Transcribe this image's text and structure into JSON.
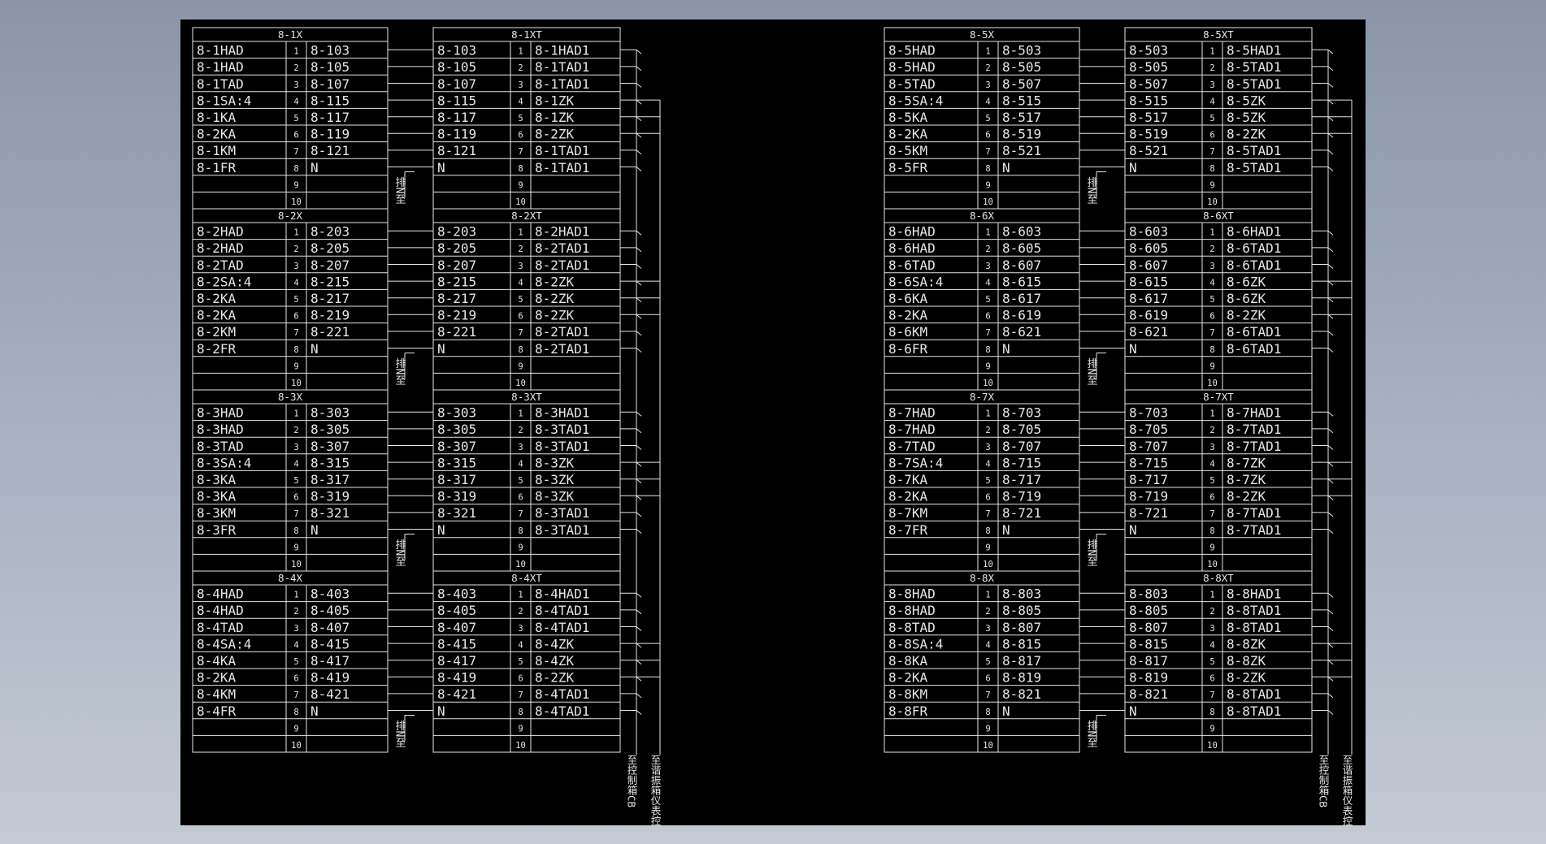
{
  "colors": {
    "paper": "#000000",
    "ink": "#e6e6e6",
    "background_top": "#8a96a8",
    "background_bottom": "#c4cad4"
  },
  "vertical_note": "排N至",
  "bottom_labels": {
    "control": "至控制箱CB",
    "meter": "至谐振箱仪表控制箱"
  },
  "sections": [
    {
      "x_title": "8-1X",
      "xt_title": "8-1XT",
      "x_rows": [
        [
          "8-1HAD",
          "1",
          "8-103"
        ],
        [
          "8-1HAD",
          "2",
          "8-105"
        ],
        [
          "8-1TAD",
          "3",
          "8-107"
        ],
        [
          "8-1SA:4",
          "4",
          "8-115"
        ],
        [
          "8-1KA",
          "5",
          "8-117"
        ],
        [
          "8-2KA",
          "6",
          "8-119"
        ],
        [
          "8-1KM",
          "7",
          "8-121"
        ],
        [
          "8-1FR",
          "8",
          "N"
        ],
        [
          "",
          "9",
          ""
        ],
        [
          "",
          "10",
          ""
        ]
      ],
      "xt_rows": [
        [
          "8-103",
          "1",
          "8-1HAD1"
        ],
        [
          "8-105",
          "2",
          "8-1TAD1"
        ],
        [
          "8-107",
          "3",
          "8-1TAD1"
        ],
        [
          "8-115",
          "4",
          "8-1ZK"
        ],
        [
          "8-117",
          "5",
          "8-1ZK"
        ],
        [
          "8-119",
          "6",
          "8-2ZK"
        ],
        [
          "8-121",
          "7",
          "8-1TAD1"
        ],
        [
          "N",
          "8",
          "8-1TAD1"
        ],
        [
          "",
          "9",
          ""
        ],
        [
          "",
          "10",
          ""
        ]
      ]
    },
    {
      "x_title": "8-2X",
      "xt_title": "8-2XT",
      "x_rows": [
        [
          "8-2HAD",
          "1",
          "8-203"
        ],
        [
          "8-2HAD",
          "2",
          "8-205"
        ],
        [
          "8-2TAD",
          "3",
          "8-207"
        ],
        [
          "8-2SA:4",
          "4",
          "8-215"
        ],
        [
          "8-2KA",
          "5",
          "8-217"
        ],
        [
          "8-2KA",
          "6",
          "8-219"
        ],
        [
          "8-2KM",
          "7",
          "8-221"
        ],
        [
          "8-2FR",
          "8",
          "N"
        ],
        [
          "",
          "9",
          ""
        ],
        [
          "",
          "10",
          ""
        ]
      ],
      "xt_rows": [
        [
          "8-203",
          "1",
          "8-2HAD1"
        ],
        [
          "8-205",
          "2",
          "8-2TAD1"
        ],
        [
          "8-207",
          "3",
          "8-2TAD1"
        ],
        [
          "8-215",
          "4",
          "8-2ZK"
        ],
        [
          "8-217",
          "5",
          "8-2ZK"
        ],
        [
          "8-219",
          "6",
          "8-2ZK"
        ],
        [
          "8-221",
          "7",
          "8-2TAD1"
        ],
        [
          "N",
          "8",
          "8-2TAD1"
        ],
        [
          "",
          "9",
          ""
        ],
        [
          "",
          "10",
          ""
        ]
      ]
    },
    {
      "x_title": "8-3X",
      "xt_title": "8-3XT",
      "x_rows": [
        [
          "8-3HAD",
          "1",
          "8-303"
        ],
        [
          "8-3HAD",
          "2",
          "8-305"
        ],
        [
          "8-3TAD",
          "3",
          "8-307"
        ],
        [
          "8-3SA:4",
          "4",
          "8-315"
        ],
        [
          "8-3KA",
          "5",
          "8-317"
        ],
        [
          "8-3KA",
          "6",
          "8-319"
        ],
        [
          "8-3KM",
          "7",
          "8-321"
        ],
        [
          "8-3FR",
          "8",
          "N"
        ],
        [
          "",
          "9",
          ""
        ],
        [
          "",
          "10",
          ""
        ]
      ],
      "xt_rows": [
        [
          "8-303",
          "1",
          "8-3HAD1"
        ],
        [
          "8-305",
          "2",
          "8-3TAD1"
        ],
        [
          "8-307",
          "3",
          "8-3TAD1"
        ],
        [
          "8-315",
          "4",
          "8-3ZK"
        ],
        [
          "8-317",
          "5",
          "8-3ZK"
        ],
        [
          "8-319",
          "6",
          "8-3ZK"
        ],
        [
          "8-321",
          "7",
          "8-3TAD1"
        ],
        [
          "N",
          "8",
          "8-3TAD1"
        ],
        [
          "",
          "9",
          ""
        ],
        [
          "",
          "10",
          ""
        ]
      ]
    },
    {
      "x_title": "8-4X",
      "xt_title": "8-4XT",
      "x_rows": [
        [
          "8-4HAD",
          "1",
          "8-403"
        ],
        [
          "8-4HAD",
          "2",
          "8-405"
        ],
        [
          "8-4TAD",
          "3",
          "8-407"
        ],
        [
          "8-4SA:4",
          "4",
          "8-415"
        ],
        [
          "8-4KA",
          "5",
          "8-417"
        ],
        [
          "8-2KA",
          "6",
          "8-419"
        ],
        [
          "8-4KM",
          "7",
          "8-421"
        ],
        [
          "8-4FR",
          "8",
          "N"
        ],
        [
          "",
          "9",
          ""
        ],
        [
          "",
          "10",
          ""
        ]
      ],
      "xt_rows": [
        [
          "8-403",
          "1",
          "8-4HAD1"
        ],
        [
          "8-405",
          "2",
          "8-4TAD1"
        ],
        [
          "8-407",
          "3",
          "8-4TAD1"
        ],
        [
          "8-415",
          "4",
          "8-4ZK"
        ],
        [
          "8-417",
          "5",
          "8-4ZK"
        ],
        [
          "8-419",
          "6",
          "8-2ZK"
        ],
        [
          "8-421",
          "7",
          "8-4TAD1"
        ],
        [
          "N",
          "8",
          "8-4TAD1"
        ],
        [
          "",
          "9",
          ""
        ],
        [
          "",
          "10",
          ""
        ]
      ]
    },
    {
      "x_title": "8-5X",
      "xt_title": "8-5XT",
      "x_rows": [
        [
          "8-5HAD",
          "1",
          "8-503"
        ],
        [
          "8-5HAD",
          "2",
          "8-505"
        ],
        [
          "8-5TAD",
          "3",
          "8-507"
        ],
        [
          "8-5SA:4",
          "4",
          "8-515"
        ],
        [
          "8-5KA",
          "5",
          "8-517"
        ],
        [
          "8-2KA",
          "6",
          "8-519"
        ],
        [
          "8-5KM",
          "7",
          "8-521"
        ],
        [
          "8-5FR",
          "8",
          "N"
        ],
        [
          "",
          "9",
          ""
        ],
        [
          "",
          "10",
          ""
        ]
      ],
      "xt_rows": [
        [
          "8-503",
          "1",
          "8-5HAD1"
        ],
        [
          "8-505",
          "2",
          "8-5TAD1"
        ],
        [
          "8-507",
          "3",
          "8-5TAD1"
        ],
        [
          "8-515",
          "4",
          "8-5ZK"
        ],
        [
          "8-517",
          "5",
          "8-5ZK"
        ],
        [
          "8-519",
          "6",
          "8-2ZK"
        ],
        [
          "8-521",
          "7",
          "8-5TAD1"
        ],
        [
          "N",
          "8",
          "8-5TAD1"
        ],
        [
          "",
          "9",
          ""
        ],
        [
          "",
          "10",
          ""
        ]
      ]
    },
    {
      "x_title": "8-6X",
      "xt_title": "8-6XT",
      "x_rows": [
        [
          "8-6HAD",
          "1",
          "8-603"
        ],
        [
          "8-6HAD",
          "2",
          "8-605"
        ],
        [
          "8-6TAD",
          "3",
          "8-607"
        ],
        [
          "8-6SA:4",
          "4",
          "8-615"
        ],
        [
          "8-6KA",
          "5",
          "8-617"
        ],
        [
          "8-2KA",
          "6",
          "8-619"
        ],
        [
          "8-6KM",
          "7",
          "8-621"
        ],
        [
          "8-6FR",
          "8",
          "N"
        ],
        [
          "",
          "9",
          ""
        ],
        [
          "",
          "10",
          ""
        ]
      ],
      "xt_rows": [
        [
          "8-603",
          "1",
          "8-6HAD1"
        ],
        [
          "8-605",
          "2",
          "8-6TAD1"
        ],
        [
          "8-607",
          "3",
          "8-6TAD1"
        ],
        [
          "8-615",
          "4",
          "8-6ZK"
        ],
        [
          "8-617",
          "5",
          "8-6ZK"
        ],
        [
          "8-619",
          "6",
          "8-2ZK"
        ],
        [
          "8-621",
          "7",
          "8-6TAD1"
        ],
        [
          "N",
          "8",
          "8-6TAD1"
        ],
        [
          "",
          "9",
          ""
        ],
        [
          "",
          "10",
          ""
        ]
      ]
    },
    {
      "x_title": "8-7X",
      "xt_title": "8-7XT",
      "x_rows": [
        [
          "8-7HAD",
          "1",
          "8-703"
        ],
        [
          "8-7HAD",
          "2",
          "8-705"
        ],
        [
          "8-7TAD",
          "3",
          "8-707"
        ],
        [
          "8-7SA:4",
          "4",
          "8-715"
        ],
        [
          "8-7KA",
          "5",
          "8-717"
        ],
        [
          "8-2KA",
          "6",
          "8-719"
        ],
        [
          "8-7KM",
          "7",
          "8-721"
        ],
        [
          "8-7FR",
          "8",
          "N"
        ],
        [
          "",
          "9",
          ""
        ],
        [
          "",
          "10",
          ""
        ]
      ],
      "xt_rows": [
        [
          "8-703",
          "1",
          "8-7HAD1"
        ],
        [
          "8-705",
          "2",
          "8-7TAD1"
        ],
        [
          "8-707",
          "3",
          "8-7TAD1"
        ],
        [
          "8-715",
          "4",
          "8-7ZK"
        ],
        [
          "8-717",
          "5",
          "8-7ZK"
        ],
        [
          "8-719",
          "6",
          "8-2ZK"
        ],
        [
          "8-721",
          "7",
          "8-7TAD1"
        ],
        [
          "N",
          "8",
          "8-7TAD1"
        ],
        [
          "",
          "9",
          ""
        ],
        [
          "",
          "10",
          ""
        ]
      ]
    },
    {
      "x_title": "8-8X",
      "xt_title": "8-8XT",
      "x_rows": [
        [
          "8-8HAD",
          "1",
          "8-803"
        ],
        [
          "8-8HAD",
          "2",
          "8-805"
        ],
        [
          "8-8TAD",
          "3",
          "8-807"
        ],
        [
          "8-8SA:4",
          "4",
          "8-815"
        ],
        [
          "8-8KA",
          "5",
          "8-817"
        ],
        [
          "8-2KA",
          "6",
          "8-819"
        ],
        [
          "8-8KM",
          "7",
          "8-821"
        ],
        [
          "8-8FR",
          "8",
          "N"
        ],
        [
          "",
          "9",
          ""
        ],
        [
          "",
          "10",
          ""
        ]
      ],
      "xt_rows": [
        [
          "8-803",
          "1",
          "8-8HAD1"
        ],
        [
          "8-805",
          "2",
          "8-8TAD1"
        ],
        [
          "8-807",
          "3",
          "8-8TAD1"
        ],
        [
          "8-815",
          "4",
          "8-8ZK"
        ],
        [
          "8-817",
          "5",
          "8-8ZK"
        ],
        [
          "8-819",
          "6",
          "8-2ZK"
        ],
        [
          "8-821",
          "7",
          "8-8TAD1"
        ],
        [
          "N",
          "8",
          "8-8TAD1"
        ],
        [
          "",
          "9",
          ""
        ],
        [
          "",
          "10",
          ""
        ]
      ]
    }
  ]
}
